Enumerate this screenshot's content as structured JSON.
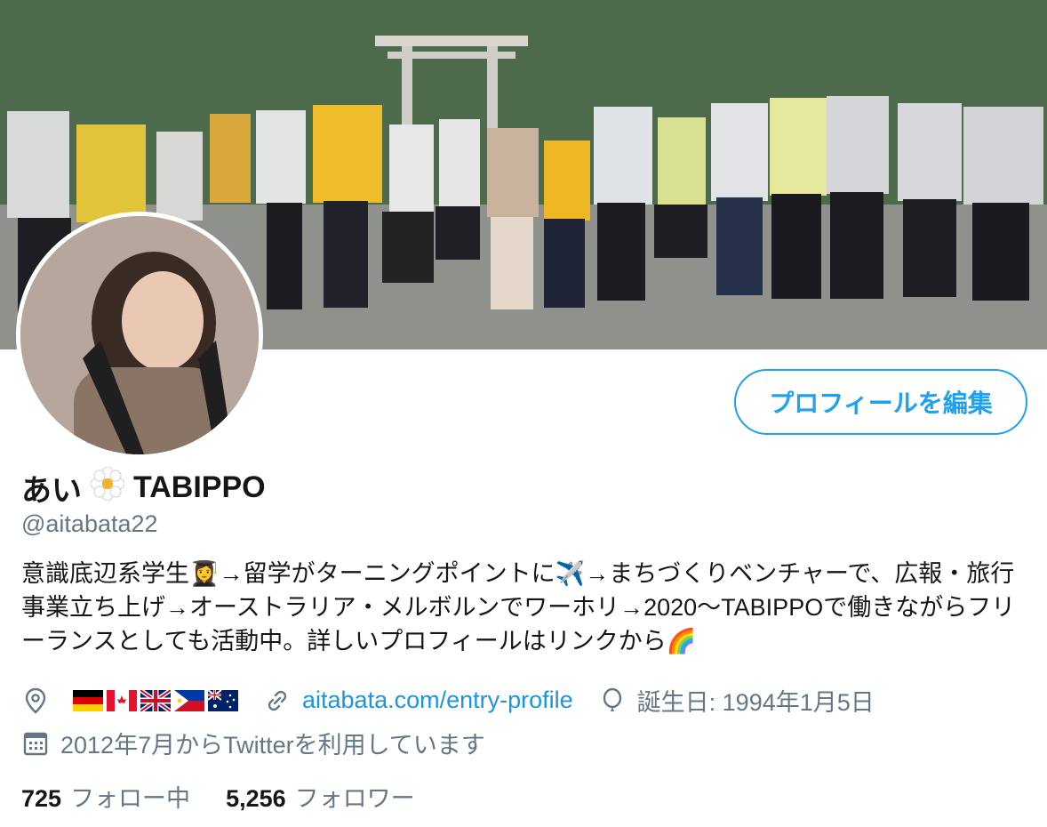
{
  "profile": {
    "name": "あい",
    "name_suffix": "TABIPPO",
    "name_emoji": "flower-emoji",
    "handle": "@aitabata22",
    "edit_button": "プロフィールを編集",
    "bio": "意識底辺系学生👩‍🎓→留学がターニングポイントに✈️→まちづくりベンチャーで、広報・旅行事業立ち上げ→オーストラリア・メルボルンでワーホリ→2020〜TABIPPOで働きながらフリーランスとしても活動中。詳しいプロフィールはリンクから🌈",
    "location_flags": [
      "germany-flag",
      "canada-flag",
      "uk-flag",
      "philippines-flag",
      "australia-flag"
    ],
    "link": "aitabata.com/entry-profile",
    "birthday": "誕生日: 1994年1月5日",
    "joined": "2012年7月からTwitterを利用しています"
  },
  "stats": {
    "following_count": "725",
    "following_label": "フォロー中",
    "followers_count": "5,256",
    "followers_label": "フォロワー"
  },
  "colors": {
    "accent": "#1da1f2",
    "secondary_text": "#657786"
  }
}
